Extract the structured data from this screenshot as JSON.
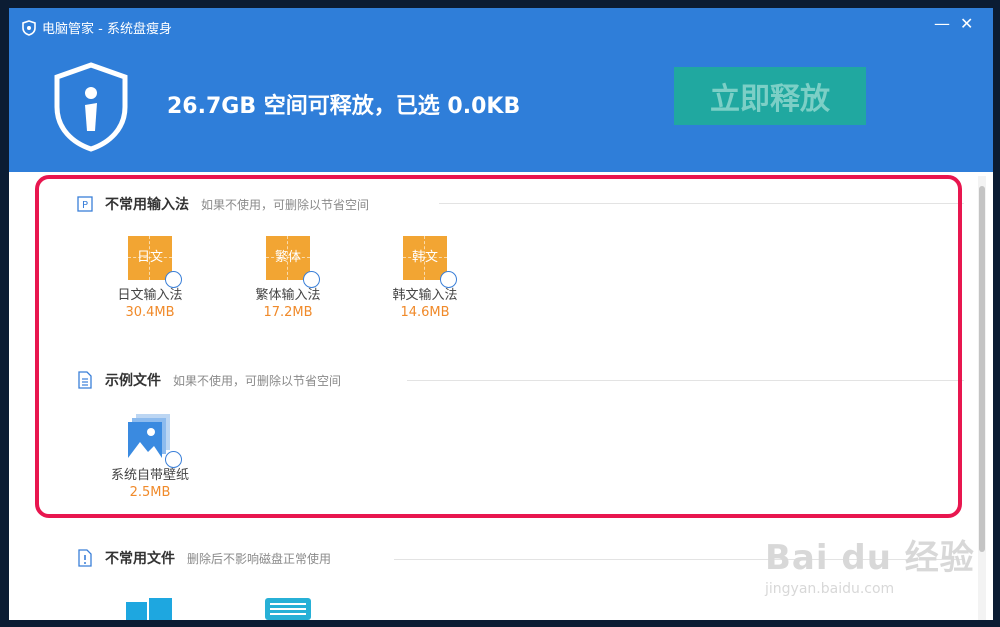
{
  "window": {
    "title": "电脑管家 - 系统盘瘦身",
    "minimize_glyph": "—",
    "close_glyph": "✕"
  },
  "header": {
    "headline": "26.7GB 空间可释放，已选 0.0KB",
    "release_button": "立即释放"
  },
  "sections": [
    {
      "title": "不常用输入法",
      "subtitle": "如果不使用，可删除以节省空间",
      "icon": "p-badge-icon",
      "items": [
        {
          "icon_text": "日文",
          "label": "日文输入法",
          "size": "30.4MB"
        },
        {
          "icon_text": "繁体",
          "label": "繁体输入法",
          "size": "17.2MB"
        },
        {
          "icon_text": "韩文",
          "label": "韩文输入法",
          "size": "14.6MB"
        }
      ]
    },
    {
      "title": "示例文件",
      "subtitle": "如果不使用，可删除以节省空间",
      "icon": "document-icon",
      "items": [
        {
          "label": "系统自带壁纸",
          "size": "2.5MB"
        }
      ]
    },
    {
      "title": "不常用文件",
      "subtitle": "删除后不影响磁盘正常使用",
      "icon": "alert-file-icon"
    }
  ],
  "watermark": {
    "main": "Bai du 经验",
    "sub": "jingyan.baidu.com"
  },
  "colors": {
    "header_blue": "#2f7ed9",
    "release_button": "#20a8a0",
    "size_orange": "#f08a2a",
    "highlight_red": "#e8164f",
    "ime_tile": "#f2a533"
  }
}
